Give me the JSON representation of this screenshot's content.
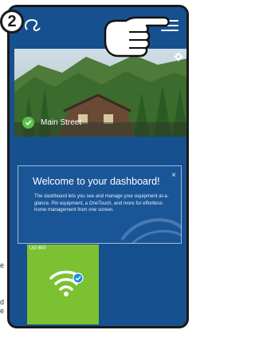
{
  "step": {
    "number": "2"
  },
  "header": {
    "logo_icon": "uponor-logo-icon",
    "menu_icon": "hamburger-menu-icon"
  },
  "hero": {
    "location_name": "Main Street",
    "settings_icon": "gear-icon",
    "status_icon": "check-icon"
  },
  "welcome_card": {
    "title": "Welcome to your dashboard!",
    "close": "×",
    "body": "The dashboard lets you see and manage your equipment at-a-glance. Pin equipment, a OneTouch, and more for effortless home management from one screen."
  },
  "device_tile": {
    "label": "UG 600",
    "icon": "wifi-icon",
    "status_icon": "check-badge-icon"
  },
  "edge_text": [
    "e",
    "d",
    "e"
  ],
  "colors": {
    "app_background": "#17508f",
    "tile_green": "#7cc131",
    "check_green": "#5fbf4c",
    "check_blue": "#1e88e5"
  }
}
